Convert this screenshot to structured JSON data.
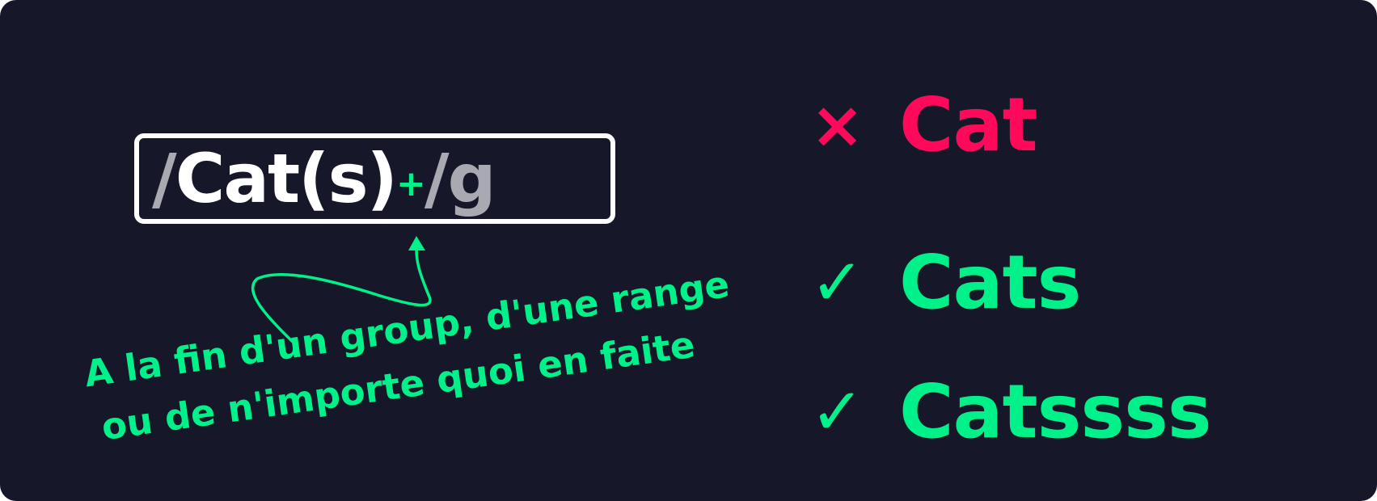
{
  "regex": {
    "open_delimiter": "/",
    "pattern": "Cat(s)",
    "quantifier": "+",
    "close_delimiter": "/",
    "flag": "g"
  },
  "note": {
    "line1": "A la fin d'un group, d'une range",
    "line2": "ou de n'importe quoi en faite"
  },
  "examples": [
    {
      "word": "Cat",
      "mark": "×",
      "matches": false,
      "color": "#ff0a5a"
    },
    {
      "word": "Cats",
      "mark": "✓",
      "matches": true,
      "color": "#00f08a"
    },
    {
      "word": "Catssss",
      "mark": "✓",
      "matches": true,
      "color": "#00f08a"
    }
  ],
  "colors": {
    "background": "#161729",
    "accent_green": "#00f08a",
    "error_red": "#ff0a5a",
    "regex_white": "#ffffff",
    "delimiter_gray": "#a9a9b2"
  }
}
